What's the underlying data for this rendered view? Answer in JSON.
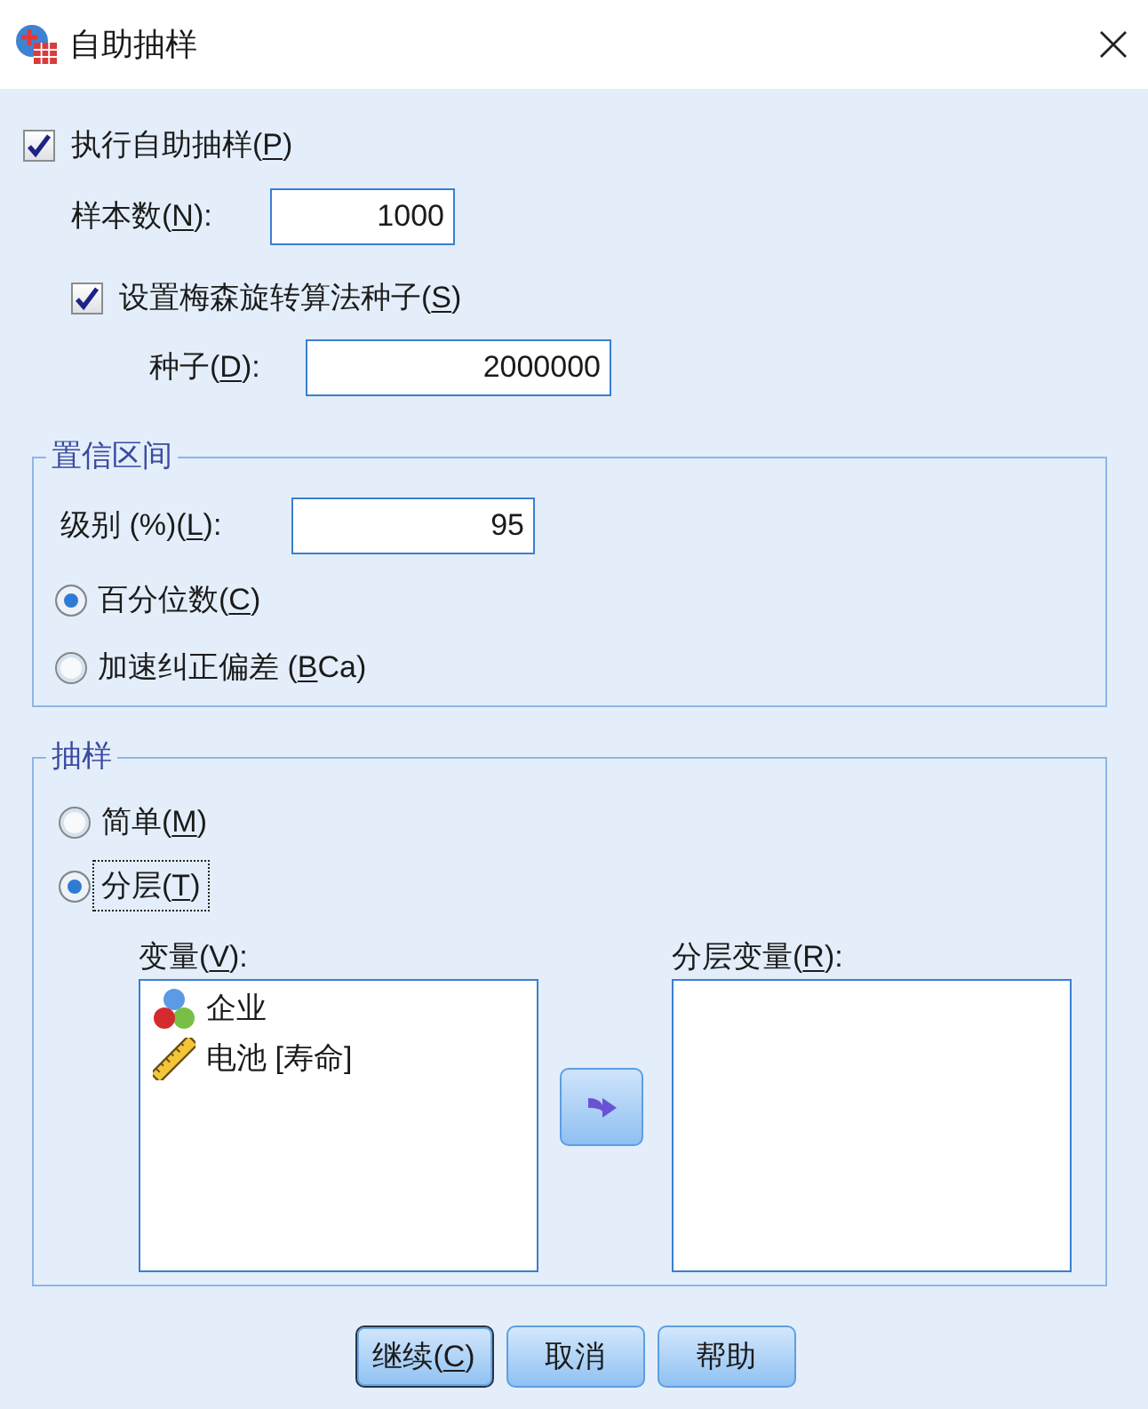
{
  "window": {
    "title": "自助抽样"
  },
  "perform_bootstrap": {
    "label": [
      "执行自助抽样(",
      "P",
      ")"
    ],
    "checked": true
  },
  "samples": {
    "label": [
      "样本数(",
      "N",
      "):"
    ],
    "value": "1000"
  },
  "set_seed": {
    "label": [
      "设置梅森旋转算法种子(",
      "S",
      ")"
    ],
    "checked": true
  },
  "seed": {
    "label": [
      "种子(",
      "D",
      "):"
    ],
    "value": "2000000"
  },
  "confidence_intervals": {
    "title": "置信区间",
    "level_field": {
      "label": [
        "级别 (%)(",
        "L",
        "):"
      ],
      "value": "95"
    },
    "methods": [
      {
        "label": [
          "百分位数(",
          "C",
          ")"
        ],
        "selected": true
      },
      {
        "label": [
          "加速纠正偏差 (",
          "B",
          "Ca)"
        ],
        "selected": false
      }
    ]
  },
  "sampling": {
    "title": "抽样",
    "methods": [
      {
        "label": [
          "简单(",
          "M",
          ")"
        ],
        "selected": false,
        "focused": false
      },
      {
        "label": [
          "分层(",
          "T",
          ")"
        ],
        "selected": true,
        "focused": true
      }
    ],
    "variables": {
      "label": [
        "变量(",
        "V",
        "):"
      ],
      "items": [
        {
          "name": "企业",
          "kind": "nominal"
        },
        {
          "name": "电池 [寿命]",
          "kind": "scale"
        }
      ]
    },
    "strata_variables": {
      "label": [
        "分层变量(",
        "R",
        "):"
      ]
    }
  },
  "buttons": [
    {
      "label": [
        "继续(",
        "C",
        ")"
      ],
      "default": true
    },
    {
      "label": [
        "取消"
      ],
      "default": false
    },
    {
      "label": [
        "帮助"
      ],
      "default": false
    }
  ]
}
